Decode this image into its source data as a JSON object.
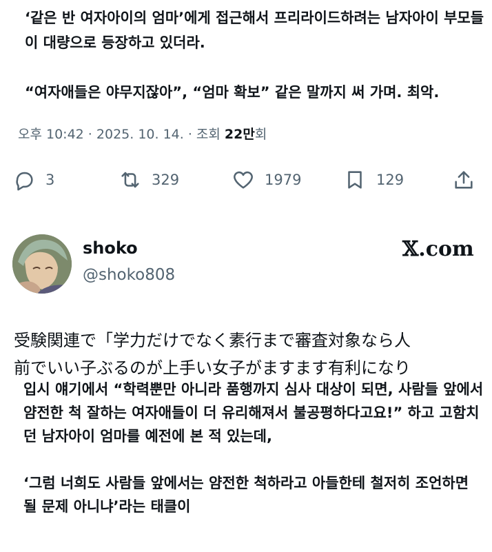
{
  "top_tweet": {
    "text": "‘같은 반 여자아이의 엄마’에게 접근해서 프리라이드하려는 남자아이 부모들이 대량으로 등장하고 있더라.\n\n“여자애들은 야무지잖아”, “엄마 확보” 같은 말까지 써 가며. 최악."
  },
  "meta": {
    "time": "오후 10:42",
    "separator": " · ",
    "date": "2025. 10. 14.",
    "separator2": " · ",
    "views_label": "조회 ",
    "views_count": "22만",
    "views_suffix": "회"
  },
  "actions": {
    "reply_count": "3",
    "retweet_count": "329",
    "like_count": "1979",
    "bookmark_count": "129"
  },
  "quoted_user": {
    "display_name": "shoko",
    "handle": "@shoko808",
    "brand": "𝕏.com"
  },
  "quoted_tweet": {
    "japanese_line1": "受験関連で「学力だけでなく素行まで審査対象なら人",
    "japanese_line2": "前でいい子ぶるのが上手い女子がますます有利になり",
    "korean_translation": "입시 얘기에서 “학력뿐만 아니라 품행까지 심사 대상이 되면, 사람들 앞에서 얌전한 척 잘하는 여자애들이 더 유리해져서 불공평하다고요!” 하고 고함치던 남자아이 엄마를 예전에 본 적 있는데,\n\n‘그럼 너희도 사람들 앞에서는 얌전한 척하라고 아들한테 철저히 조언하면 될 문제 아니냐’라는 태클이"
  },
  "icons": {
    "reply": "reply-icon",
    "retweet": "retweet-icon",
    "like": "heart-icon",
    "bookmark": "bookmark-icon",
    "share": "share-icon"
  },
  "colors": {
    "text": "#0f1419",
    "secondary": "#536471"
  }
}
